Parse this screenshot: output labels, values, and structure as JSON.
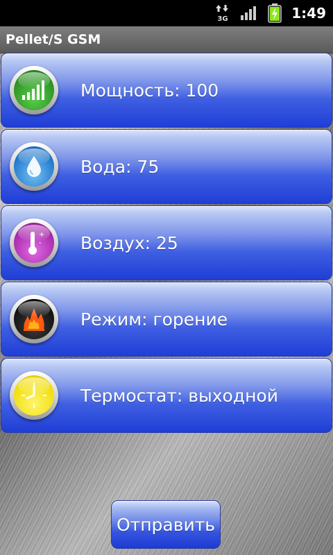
{
  "status_bar": {
    "time": "1:49",
    "network_type": "3G",
    "icons": [
      "data-arrows-icon",
      "signal-bars-icon",
      "battery-charging-icon"
    ],
    "battery_color": "#8ee81a"
  },
  "app": {
    "title": "Pellet/S GSM"
  },
  "rows": [
    {
      "label": "Мощность: 100",
      "icon": "power-level-icon",
      "icon_color": "#35a52b"
    },
    {
      "label": "Вода: 75",
      "icon": "water-drop-icon",
      "icon_color": "#2a86d8"
    },
    {
      "label": "Воздух: 25",
      "icon": "thermometer-icon",
      "icon_color": "#b22bb5"
    },
    {
      "label": "Режим: горение",
      "icon": "flame-icon",
      "icon_color": "#1a1a1a"
    },
    {
      "label": "Термостат: выходной",
      "icon": "clock-icon",
      "icon_color": "#f2e20f"
    }
  ],
  "send_button": {
    "label": "Отправить"
  },
  "colors": {
    "button_blue": "#3555df",
    "titlebar": "#6b6b6b"
  }
}
